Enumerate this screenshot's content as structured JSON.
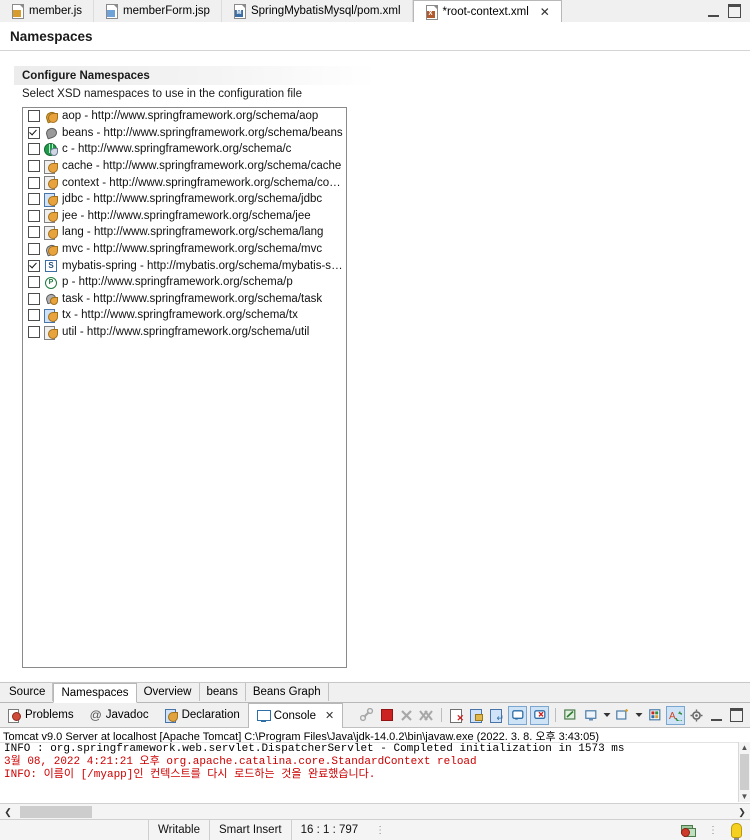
{
  "editor_tabs": [
    {
      "label": "member.js",
      "icon": "js-file-icon",
      "active": false,
      "closable": false,
      "mark": "JS",
      "mark_color": "#d89b2e"
    },
    {
      "label": "memberForm.jsp",
      "icon": "jsp-file-icon",
      "active": false,
      "closable": false,
      "mark": "",
      "mark_color": "#6fa3d8"
    },
    {
      "label": "SpringMybatisMysql/pom.xml",
      "icon": "maven-pom-file-icon",
      "active": false,
      "closable": false,
      "mark": "M",
      "mark_color": "#3a6ea5"
    },
    {
      "label": "*root-context.xml",
      "icon": "spring-config-file-icon",
      "active": true,
      "closable": true,
      "mark": "X",
      "mark_color": "#b05a2e"
    }
  ],
  "window_buttons": {
    "minimize": "minimize-editor",
    "maximize": "maximize-editor"
  },
  "page_title": "Namespaces",
  "section": {
    "header": "Configure Namespaces",
    "description": "Select XSD namespaces to use in the configuration file"
  },
  "namespaces": [
    {
      "prefix": "aop",
      "uri": "http://www.springframework.org/schema/aop",
      "label": "aop - http://www.springframework.org/schema/aop",
      "checked": false,
      "icon": "aop-namespace-icon"
    },
    {
      "prefix": "beans",
      "uri": "http://www.springframework.org/schema/beans",
      "label": "beans - http://www.springframework.org/schema/beans",
      "checked": true,
      "icon": "beans-namespace-icon"
    },
    {
      "prefix": "c",
      "uri": "http://www.springframework.org/schema/c",
      "label": "c - http://www.springframework.org/schema/c",
      "checked": false,
      "icon": "c-namespace-icon"
    },
    {
      "prefix": "cache",
      "uri": "http://www.springframework.org/schema/cache",
      "label": "cache - http://www.springframework.org/schema/cache",
      "checked": false,
      "icon": "cache-namespace-icon"
    },
    {
      "prefix": "context",
      "uri": "http://www.springframework.org/schema/context",
      "label": "context - http://www.springframework.org/schema/context",
      "checked": false,
      "icon": "context-namespace-icon"
    },
    {
      "prefix": "jdbc",
      "uri": "http://www.springframework.org/schema/jdbc",
      "label": "jdbc - http://www.springframework.org/schema/jdbc",
      "checked": false,
      "icon": "jdbc-namespace-icon"
    },
    {
      "prefix": "jee",
      "uri": "http://www.springframework.org/schema/jee",
      "label": "jee - http://www.springframework.org/schema/jee",
      "checked": false,
      "icon": "jee-namespace-icon"
    },
    {
      "prefix": "lang",
      "uri": "http://www.springframework.org/schema/lang",
      "label": "lang - http://www.springframework.org/schema/lang",
      "checked": false,
      "icon": "lang-namespace-icon"
    },
    {
      "prefix": "mvc",
      "uri": "http://www.springframework.org/schema/mvc",
      "label": "mvc - http://www.springframework.org/schema/mvc",
      "checked": false,
      "icon": "mvc-namespace-icon"
    },
    {
      "prefix": "mybatis-spring",
      "uri": "http://mybatis.org/schema/mybatis-spring",
      "label": "mybatis-spring - http://mybatis.org/schema/mybatis-spring",
      "checked": true,
      "icon": "mybatis-spring-namespace-icon"
    },
    {
      "prefix": "p",
      "uri": "http://www.springframework.org/schema/p",
      "label": "p - http://www.springframework.org/schema/p",
      "checked": false,
      "icon": "p-namespace-icon"
    },
    {
      "prefix": "task",
      "uri": "http://www.springframework.org/schema/task",
      "label": "task - http://www.springframework.org/schema/task",
      "checked": false,
      "icon": "task-namespace-icon"
    },
    {
      "prefix": "tx",
      "uri": "http://www.springframework.org/schema/tx",
      "label": "tx - http://www.springframework.org/schema/tx",
      "checked": false,
      "icon": "tx-namespace-icon"
    },
    {
      "prefix": "util",
      "uri": "http://www.springframework.org/schema/util",
      "label": "util - http://www.springframework.org/schema/util",
      "checked": false,
      "icon": "util-namespace-icon"
    }
  ],
  "form_tabs": [
    {
      "label": "Source",
      "active": false
    },
    {
      "label": "Namespaces",
      "active": true
    },
    {
      "label": "Overview",
      "active": false
    },
    {
      "label": "beans",
      "active": false
    },
    {
      "label": "Beans Graph",
      "active": false
    }
  ],
  "view_tabs": [
    {
      "label": "Problems",
      "icon": "problems-icon",
      "active": false,
      "closable": false
    },
    {
      "label": "Javadoc",
      "icon": "javadoc-at-icon",
      "active": false,
      "closable": false
    },
    {
      "label": "Declaration",
      "icon": "declaration-icon",
      "active": false,
      "closable": false
    },
    {
      "label": "Console",
      "icon": "console-monitor-icon",
      "active": true,
      "closable": true
    }
  ],
  "console_toolbar": [
    {
      "name": "link-with-editor-icon",
      "glyph": "link",
      "enabled": false,
      "selected": false
    },
    {
      "name": "terminate-icon",
      "glyph": "stop-square",
      "enabled": true,
      "selected": false,
      "color": "#cc2222"
    },
    {
      "name": "remove-launch-icon",
      "glyph": "x",
      "enabled": false,
      "selected": false
    },
    {
      "name": "remove-all-launches-icon",
      "glyph": "xx",
      "enabled": false,
      "selected": false
    },
    {
      "name": "clear-console-icon",
      "glyph": "clear",
      "enabled": true,
      "selected": false
    },
    {
      "name": "scroll-lock-icon",
      "glyph": "lock",
      "enabled": true,
      "selected": false
    },
    {
      "name": "word-wrap-icon",
      "glyph": "wrap",
      "enabled": true,
      "selected": false
    },
    {
      "name": "show-console-on-output-icon",
      "glyph": "console-out",
      "enabled": true,
      "selected": true
    },
    {
      "name": "show-console-on-error-icon",
      "glyph": "console-err",
      "enabled": true,
      "selected": true
    },
    {
      "name": "pin-console-icon",
      "glyph": "pin",
      "enabled": true,
      "selected": false
    },
    {
      "name": "display-selected-console-icon",
      "glyph": "monitor",
      "enabled": true,
      "selected": false,
      "has_dropdown": true
    },
    {
      "name": "open-console-icon",
      "glyph": "new-console",
      "enabled": true,
      "selected": false,
      "has_dropdown": true
    },
    {
      "name": "servers-icon",
      "glyph": "servers",
      "enabled": true,
      "selected": false
    },
    {
      "name": "auto-scroll-icon",
      "glyph": "auto-scroll",
      "enabled": true,
      "selected": true
    },
    {
      "name": "view-menu-icon",
      "glyph": "gear",
      "enabled": true,
      "selected": false
    },
    {
      "name": "minimize-view-icon",
      "glyph": "minimize",
      "enabled": true,
      "selected": false
    },
    {
      "name": "maximize-view-icon",
      "glyph": "maximize",
      "enabled": true,
      "selected": false
    }
  ],
  "console": {
    "header": "Tomcat v9.0 Server at localhost [Apache Tomcat] C:\\Program Files\\Java\\jdk-14.0.2\\bin\\javaw.exe  (2022. 3. 8. 오후 3:43:05)",
    "lines": [
      {
        "text": "INFO : org.springframework.web.servlet.DispatcherServlet - Completed initialization in 1573 ms",
        "color": "black"
      },
      {
        "text": "3월 08, 2022 4:21:21 오후 org.apache.catalina.core.StandardContext reload",
        "color": "red"
      },
      {
        "text": "INFO: 이름이 [/myapp]인 컨텍스트를 다시 로드하는 것을 완료했습니다.",
        "color": "red"
      }
    ],
    "error_color": "#cc0000",
    "text_color": "#000000"
  },
  "status_bar": {
    "writable": "Writable",
    "insert_mode": "Smart Insert",
    "cursor_position": "16 : 1 : 797",
    "icons": [
      {
        "name": "build-status-icon"
      },
      {
        "name": "tip-of-the-day-icon"
      }
    ]
  }
}
